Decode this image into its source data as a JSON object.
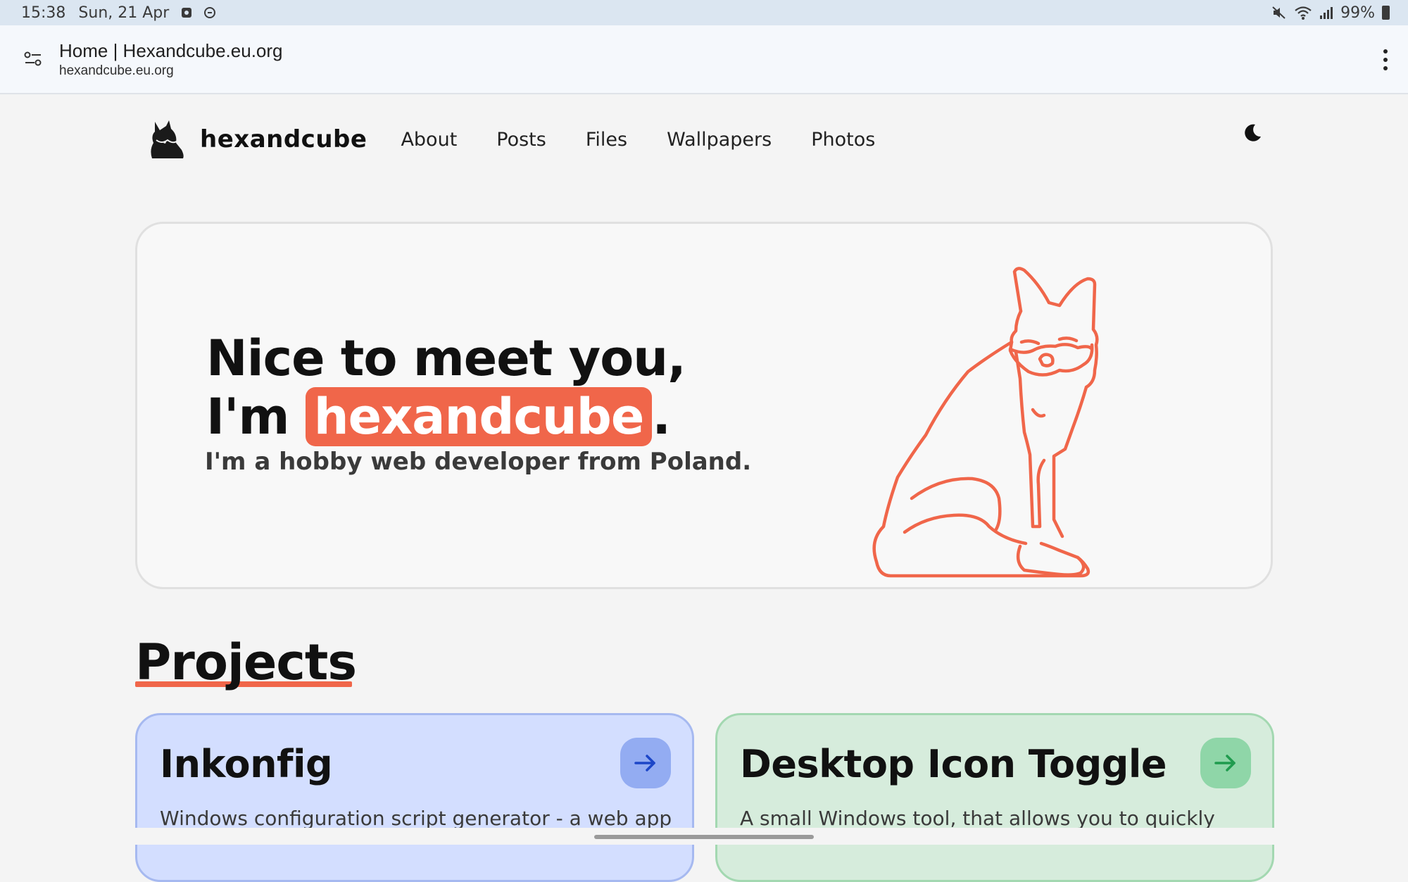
{
  "status_bar": {
    "time": "15:38",
    "date": "Sun, 21 Apr",
    "battery": "99%",
    "icons": [
      "screenshot-icon",
      "do-not-disturb-icon",
      "mute-icon",
      "wifi-icon",
      "signal-icon",
      "battery-icon"
    ]
  },
  "browser": {
    "tab_title": "Home | Hexandcube.eu.org",
    "url": "hexandcube.eu.org",
    "icons": [
      "site-settings-icon",
      "more-menu-icon"
    ]
  },
  "nav": {
    "brand": "hexandcube",
    "links": [
      "About",
      "Posts",
      "Files",
      "Wallpapers",
      "Photos"
    ],
    "icons": [
      "fox-logo-icon",
      "moon-icon"
    ]
  },
  "hero": {
    "line1": "Nice to meet you,",
    "line2_prefix": "I'm ",
    "line2_highlight": "hexandcube",
    "line2_suffix": ".",
    "subtitle": "I'm a hobby web developer from Poland.",
    "illustration": "fox-outline-illustration",
    "accent_color": "#f0664a"
  },
  "projects": {
    "title": "Projects",
    "cards": [
      {
        "title": "Inkonfig",
        "description": "Windows configuration script generator - a web app",
        "color": "#d3deff",
        "arrow_color": "#1c46c8"
      },
      {
        "title": "Desktop Icon Toggle",
        "description": "A small Windows tool, that allows you to quickly",
        "color": "#d6ecdc",
        "arrow_color": "#1f9b4e"
      }
    ]
  }
}
